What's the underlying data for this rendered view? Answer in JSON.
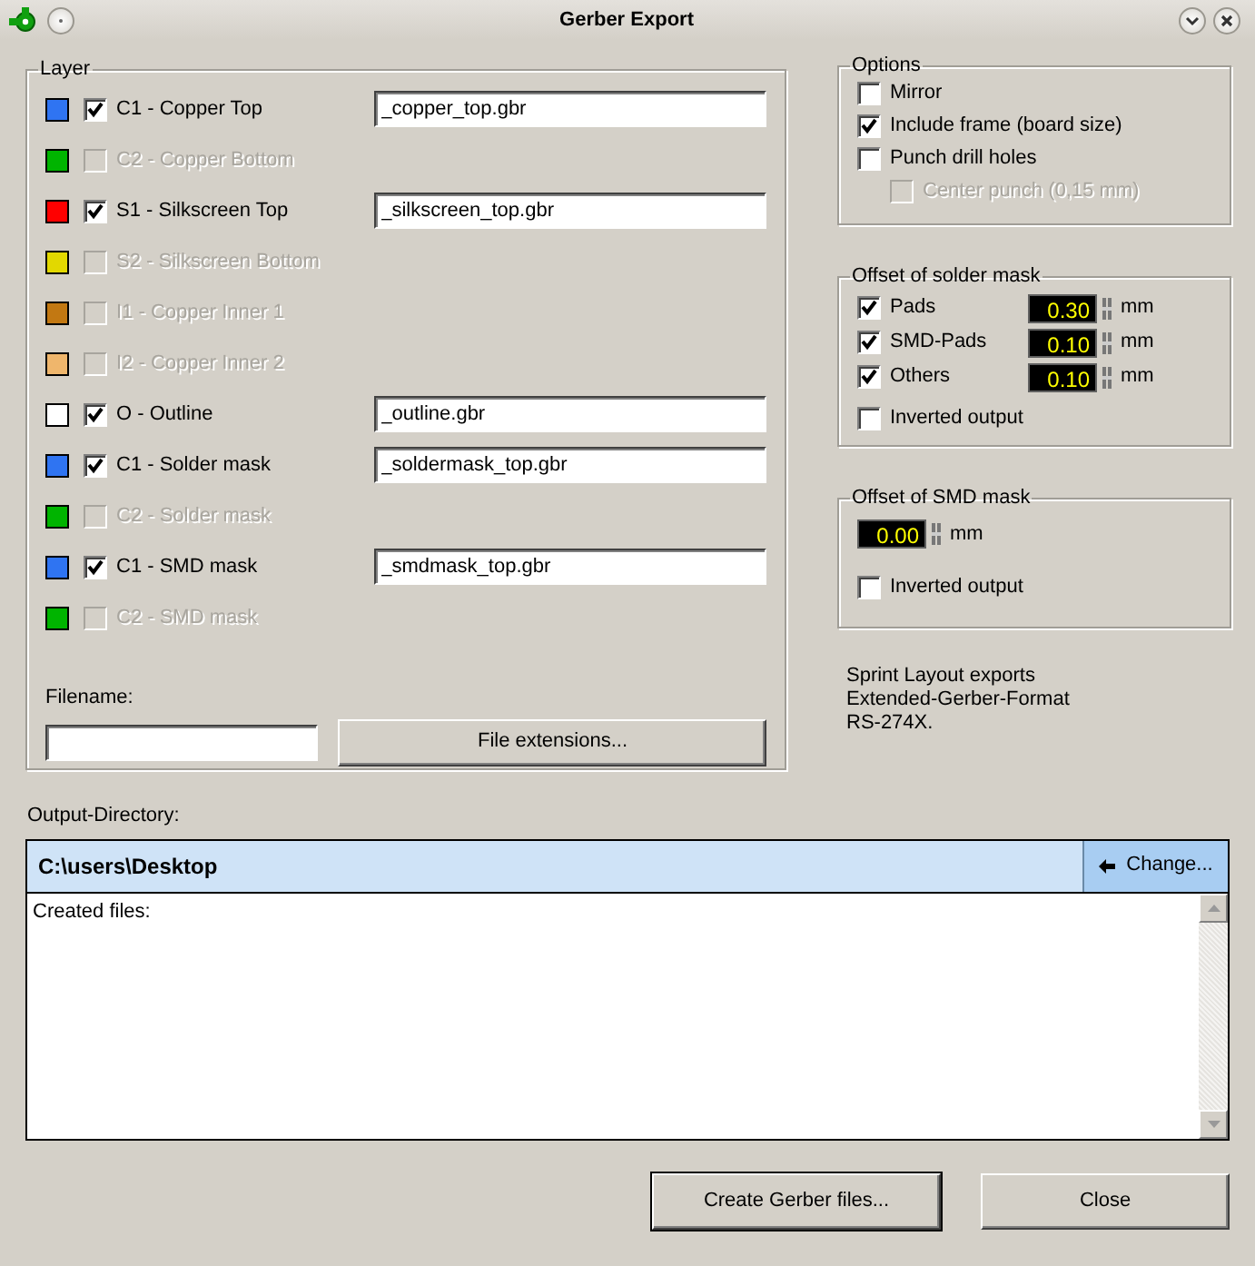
{
  "window": {
    "title": "Gerber Export"
  },
  "layer_group": {
    "title": "Layer",
    "layers": [
      {
        "label": "C1 - Copper Top",
        "color": "#2f74f2",
        "checked": true,
        "disabled": false,
        "filename": "_copper_top.gbr"
      },
      {
        "label": "C2 - Copper Bottom",
        "color": "#00b400",
        "checked": false,
        "disabled": true
      },
      {
        "label": "S1 - Silkscreen Top",
        "color": "#ff0000",
        "checked": true,
        "disabled": false,
        "filename": "_silkscreen_top.gbr"
      },
      {
        "label": "S2 - Silkscreen Bottom",
        "color": "#e2d800",
        "checked": false,
        "disabled": true
      },
      {
        "label": "I1 - Copper Inner 1",
        "color": "#c27812",
        "checked": false,
        "disabled": true
      },
      {
        "label": "I2 - Copper Inner 2",
        "color": "#efb66c",
        "checked": false,
        "disabled": true
      },
      {
        "label": "O - Outline",
        "color": "#ffffff",
        "checked": true,
        "disabled": false,
        "filename": "_outline.gbr"
      },
      {
        "label": "C1 - Solder mask",
        "color": "#2f74f2",
        "checked": true,
        "disabled": false,
        "filename": "_soldermask_top.gbr"
      },
      {
        "label": "C2 - Solder mask",
        "color": "#00b400",
        "checked": false,
        "disabled": true
      },
      {
        "label": "C1 - SMD mask",
        "color": "#2f74f2",
        "checked": true,
        "disabled": false,
        "filename": "_smdmask_top.gbr"
      },
      {
        "label": "C2 - SMD mask",
        "color": "#00b400",
        "checked": false,
        "disabled": true
      }
    ],
    "filename_label": "Filename:",
    "extensions_button": "File extensions..."
  },
  "options": {
    "title": "Options",
    "items": [
      {
        "label": "Mirror",
        "checked": false,
        "disabled": false
      },
      {
        "label": "Include frame (board size)",
        "checked": true,
        "disabled": false
      },
      {
        "label": "Punch drill holes",
        "checked": false,
        "disabled": false,
        "children": [
          {
            "label": "Center punch (0,15 mm)",
            "checked": false,
            "disabled": true
          }
        ]
      }
    ]
  },
  "solder_mask": {
    "title": "Offset of solder mask",
    "rows": [
      {
        "label": "Pads",
        "checked": true,
        "value": "0.30",
        "unit": "mm"
      },
      {
        "label": "SMD-Pads",
        "checked": true,
        "value": "0.10",
        "unit": "mm"
      },
      {
        "label": "Others",
        "checked": true,
        "value": "0.10",
        "unit": "mm"
      }
    ],
    "inverted": {
      "label": "Inverted output",
      "checked": false
    }
  },
  "smd_mask": {
    "title": "Offset of SMD mask",
    "value": "0.00",
    "unit": "mm",
    "inverted": {
      "label": "Inverted output",
      "checked": false
    }
  },
  "info": [
    "Sprint Layout exports",
    "Extended-Gerber-Format",
    "RS-274X."
  ],
  "output": {
    "label": "Output-Directory:",
    "path": "C:\\users\\Desktop",
    "change_button": "Change...",
    "log": "Created files:"
  },
  "buttons": [
    {
      "label": "Create Gerber files..."
    },
    {
      "label": "Close"
    }
  ]
}
